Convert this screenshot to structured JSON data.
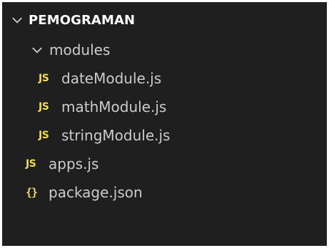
{
  "explorer": {
    "root": {
      "label": "PEMOGRAMAN",
      "expanded": true,
      "chevron_icon": "chevron-down-icon"
    },
    "folders": [
      {
        "label": "modules",
        "expanded": true,
        "chevron_icon": "chevron-down-icon",
        "files": [
          {
            "label": "dateModule.js",
            "icon": "JS"
          },
          {
            "label": "mathModule.js",
            "icon": "JS"
          },
          {
            "label": "stringModule.js",
            "icon": "JS"
          }
        ]
      }
    ],
    "root_files": [
      {
        "label": "apps.js",
        "icon": "JS"
      },
      {
        "label": "package.json",
        "icon": "{}"
      }
    ],
    "colors": {
      "background": "#1f1f1f",
      "text": "#cccccc",
      "header_text": "#ffffff",
      "js_icon": "#f1dc4b",
      "json_icon": "#f1dc4b"
    }
  }
}
